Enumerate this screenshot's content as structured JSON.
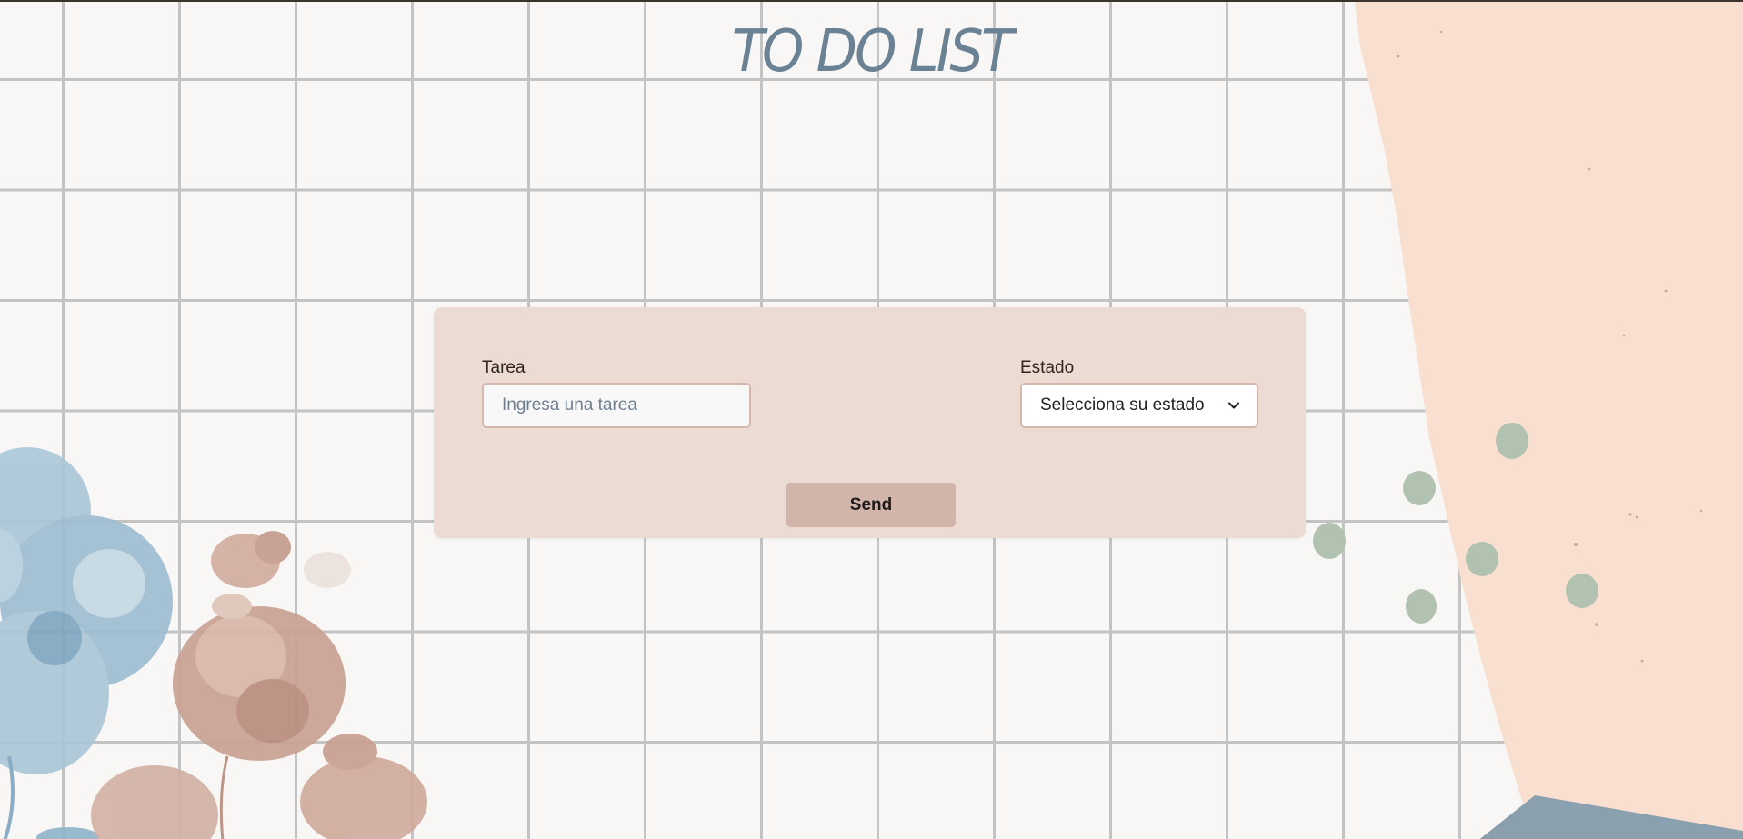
{
  "header": {
    "title": "TO DO LIST"
  },
  "form": {
    "task_label": "Tarea",
    "task_placeholder": "Ingresa una tarea",
    "task_value": "",
    "status_label": "Estado",
    "status_selected": "Selecciona su estado",
    "send_label": "Send"
  },
  "icons": {
    "select_arrow": "chevron-down-icon"
  },
  "colors": {
    "card_background": "#ecdbd2",
    "button_background": "#d1b4aa",
    "title_color": "#6a8293",
    "peach_panel": "#f9dfcf",
    "green_dots": "#b1c2b0",
    "blue_flowers": "#9dbdd2",
    "pink_flowers": "#c39b8d"
  }
}
